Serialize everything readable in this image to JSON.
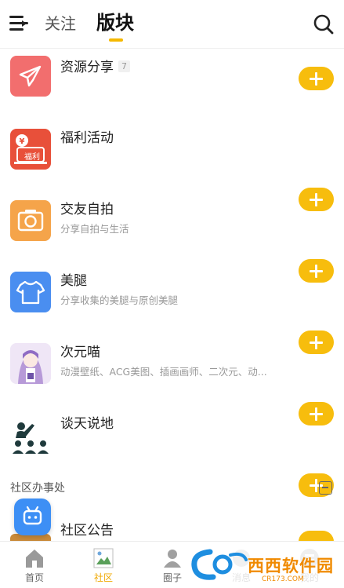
{
  "header": {
    "tabs": [
      {
        "label": "关注",
        "active": false
      },
      {
        "label": "版块",
        "active": true
      }
    ],
    "accent_color": "#f5b800"
  },
  "forums": [
    {
      "title": "资源分享",
      "badge": "7",
      "subtitle": "",
      "icon": "paper-plane-icon"
    },
    {
      "title": "福利活动",
      "subtitle": "",
      "icon": "welfare-gift-icon",
      "icon_text": "福利"
    },
    {
      "title": "交友自拍",
      "subtitle": "分享自拍与生活",
      "icon": "camera-icon"
    },
    {
      "title": "美腿",
      "subtitle": "分享收集的美腿与原创美腿",
      "icon": "tshirt-icon"
    },
    {
      "title": "次元喵",
      "subtitle": "动漫壁纸、ACG美图、插画画师、二次元、动...",
      "icon": "anime-thumbnail"
    },
    {
      "title": "谈天说地",
      "subtitle": "",
      "icon": "discussion-group-icon"
    }
  ],
  "section": {
    "title": "社区办事处",
    "items": [
      {
        "title": "社区公告"
      }
    ]
  },
  "bottom_nav": [
    {
      "label": "首页",
      "icon": "home-icon",
      "active": false
    },
    {
      "label": "社区",
      "icon": "community-icon",
      "active": true
    },
    {
      "label": "圈子",
      "icon": "circle-icon",
      "active": false
    },
    {
      "label": "消息",
      "icon": "message-icon",
      "active": false
    },
    {
      "label": "我的",
      "icon": "profile-icon",
      "active": false
    }
  ],
  "watermark": {
    "text": "西西软件园",
    "url": "CR173.COM"
  },
  "colors": {
    "add_button": "#f7bd0d",
    "active_nav": "#f0a800"
  }
}
